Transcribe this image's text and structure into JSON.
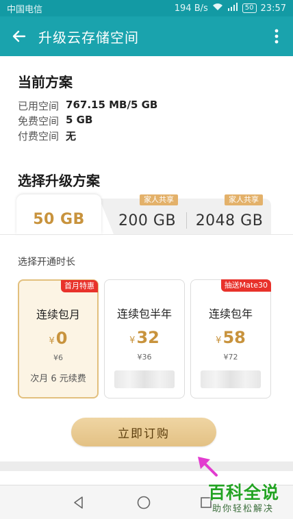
{
  "status_bar": {
    "carrier": "中国电信",
    "speed": "194 B/s",
    "battery": "50",
    "time": "23:57"
  },
  "app_bar": {
    "title": "升级云存储空间"
  },
  "current_plan": {
    "title": "当前方案",
    "rows": [
      {
        "label": "已用空间",
        "value": "767.15 MB/5 GB"
      },
      {
        "label": "免费空间",
        "value": "5 GB"
      },
      {
        "label": "付费空间",
        "value": "无"
      }
    ]
  },
  "upgrade": {
    "title": "选择升级方案",
    "tabs": [
      {
        "label": "50 GB",
        "badge": ""
      },
      {
        "label": "200 GB",
        "badge": "家人共享"
      },
      {
        "label": "2048 GB",
        "badge": "家人共享"
      }
    ],
    "selected_tab": 0
  },
  "duration": {
    "label": "选择开通时长",
    "currency": "¥",
    "options": [
      {
        "name": "连续包月",
        "price": "0",
        "original": "¥6",
        "renew": "次月 6 元续费",
        "promo": "首月特惠",
        "selected": true
      },
      {
        "name": "连续包半年",
        "price": "32",
        "original": "¥36",
        "renew": "",
        "promo": "",
        "selected": false
      },
      {
        "name": "连续包年",
        "price": "58",
        "original": "¥72",
        "renew": "",
        "promo": "抽送Mate30",
        "selected": false
      }
    ]
  },
  "actions": {
    "subscribe": "立即订购"
  },
  "watermark": {
    "title": "百科全说",
    "subtitle": "助你轻松解决"
  },
  "colors": {
    "header": "#1aa3ad",
    "gold": "#c8933d",
    "promo_red": "#e8322b",
    "button_gold": "#e3c184"
  }
}
